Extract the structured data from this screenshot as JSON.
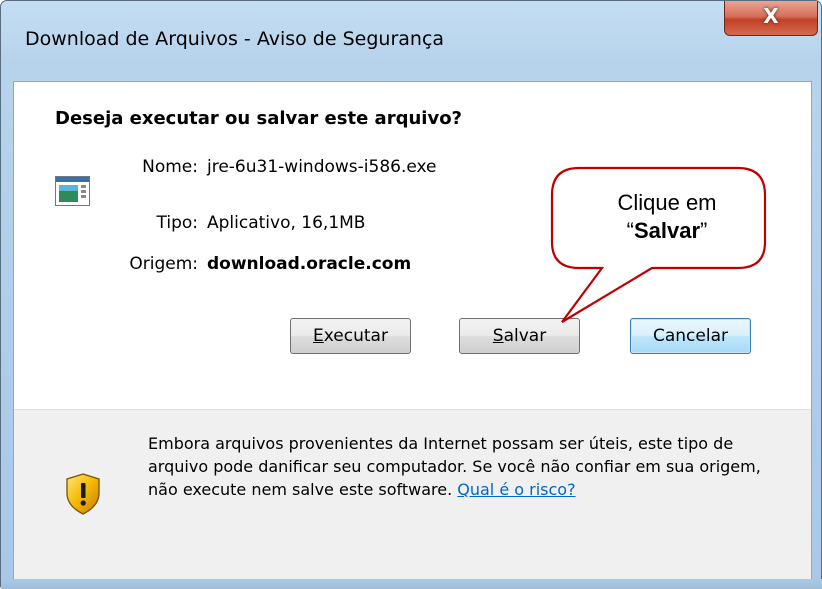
{
  "window": {
    "title": "Download de Arquivos - Aviso de Segurança",
    "close_label": "X"
  },
  "dialog": {
    "question": "Deseja executar ou salvar este arquivo?",
    "file_icon": "application-window-icon",
    "fields": [
      {
        "label": "Nome:",
        "value": "jre-6u31-windows-i586.exe"
      },
      {
        "label": "Tipo:",
        "value": "Aplicativo, 16,1MB"
      },
      {
        "label": "Origem:",
        "value": "download.oracle.com"
      }
    ],
    "buttons": {
      "run": {
        "mnemonic": "E",
        "rest": "xecutar"
      },
      "save": {
        "mnemonic": "S",
        "rest": "alvar"
      },
      "cancel": "Cancelar"
    }
  },
  "warning": {
    "icon": "security-shield-icon",
    "text": "Embora arquivos provenientes da Internet possam ser úteis, este tipo de arquivo pode danificar seu computador. Se você não confiar em sua origem, não execute nem salve este software. ",
    "link": "Qual é o risco?"
  },
  "callout": {
    "line1": "Clique em",
    "quote_open": "“",
    "emphasis": "Salvar",
    "quote_close": "”",
    "color_border": "#c00000"
  }
}
